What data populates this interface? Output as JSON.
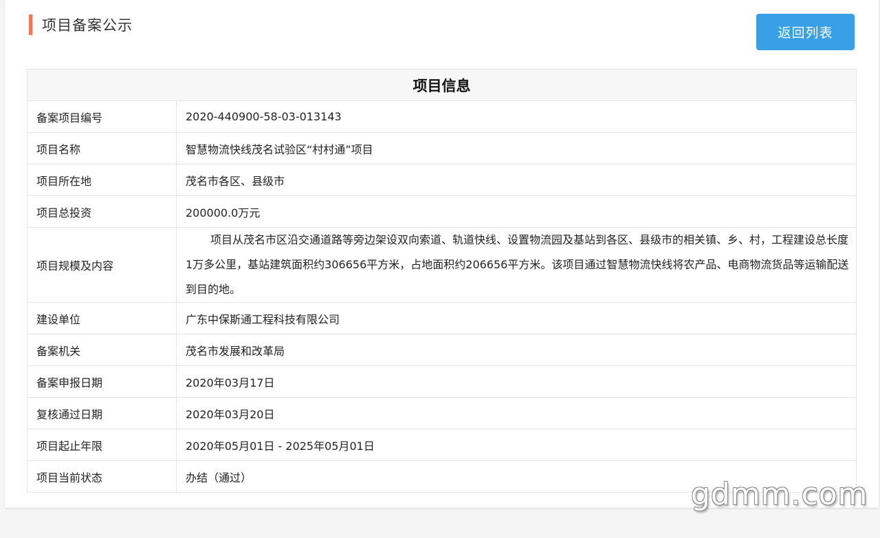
{
  "header": {
    "title": "项目备案公示",
    "back_button": "返回列表"
  },
  "table": {
    "heading": "项目信息",
    "rows": [
      {
        "label": "备案项目编号",
        "value": "2020-440900-58-03-013143"
      },
      {
        "label": "项目名称",
        "value": "智慧物流快线茂名试验区“村村通”项目"
      },
      {
        "label": "项目所在地",
        "value": "茂名市各区、县级市"
      },
      {
        "label": "项目总投资",
        "value": "200000.0万元"
      },
      {
        "label": "项目规模及内容",
        "value": "项目从茂名市区沿交通道路等旁边架设双向索道、轨道快线、设置物流园及基站到各区、县级市的相关镇、乡、村，工程建设总长度1万多公里，基站建筑面积约306656平方米，占地面积约206656平方米。该项目通过智慧物流快线将农产品、电商物流货品等运输配送到目的地。"
      },
      {
        "label": "建设单位",
        "value": "广东中保斯通工程科技有限公司"
      },
      {
        "label": "备案机关",
        "value": "茂名市发展和改革局"
      },
      {
        "label": "备案申报日期",
        "value": "2020年03月17日"
      },
      {
        "label": "复核通过日期",
        "value": "2020年03月20日"
      },
      {
        "label": "项目起止年限",
        "value": "2020年05月01日 - 2025年05月01日"
      },
      {
        "label": "项目当前状态",
        "value": "办结（通过）"
      }
    ]
  },
  "watermark": "gdmm.com",
  "colors": {
    "accent_bar": "#f2785c",
    "button_bg": "#3aa0e6"
  }
}
